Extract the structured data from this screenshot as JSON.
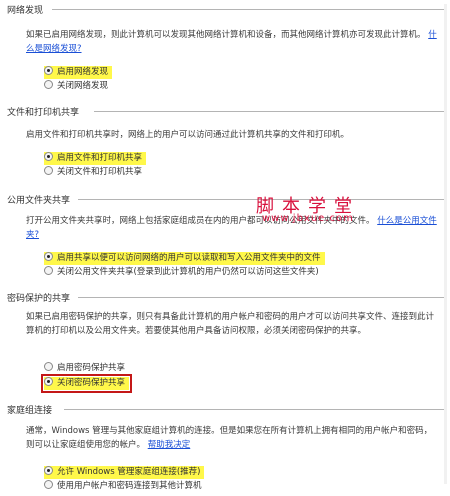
{
  "network_discovery": {
    "title": "网络发现",
    "description": "如果已启用网络发现，则此计算机可以发现其他网络计算机和设备，而其他网络计算机亦可发现此计算机。",
    "link": "什么是网络发现?",
    "options": [
      {
        "label": "启用网络发现",
        "selected": true,
        "highlighted": true
      },
      {
        "label": "关闭网络发现",
        "selected": false,
        "highlighted": false
      }
    ]
  },
  "file_printer_sharing": {
    "title": "文件和打印机共享",
    "description": "启用文件和打印机共享时，网络上的用户可以访问通过此计算机共享的文件和打印机。",
    "options": [
      {
        "label": "启用文件和打印机共享",
        "selected": true,
        "highlighted": true
      },
      {
        "label": "关闭文件和打印机共享",
        "selected": false,
        "highlighted": false
      }
    ]
  },
  "public_folder_sharing": {
    "title": "公用文件夹共享",
    "description": "打开公用文件夹共享时，网络上包括家庭组成员在内的用户都可以访问公用文件夹中的文件。",
    "link": "什么是公用文件夹?",
    "options": [
      {
        "label": "启用共享以便可以访问网络的用户可以读取和写入公用文件夹中的文件",
        "selected": true,
        "highlighted": true
      },
      {
        "label": "关闭公用文件夹共享(登录到此计算机的用户仍然可以访问这些文件夹)",
        "selected": false,
        "highlighted": false
      }
    ]
  },
  "password_protected_sharing": {
    "title": "密码保护的共享",
    "description": "如果已启用密码保护的共享，则只有具备此计算机的用户帐户和密码的用户才可以访问共享文件、连接到此计算机的打印机以及公用文件夹。若要使其他用户具备访问权限，必须关闭密码保护的共享。",
    "options": [
      {
        "label": "启用密码保护共享",
        "selected": false,
        "highlighted": false
      },
      {
        "label": "关闭密码保护共享",
        "selected": true,
        "highlighted": true
      }
    ]
  },
  "homegroup_connections": {
    "title": "家庭组连接",
    "description": "通常，Windows 管理与其他家庭组计算机的连接。但是如果您在所有计算机上拥有相同的用户帐户和密码，则可以让家庭组使用您的帐户。",
    "link": "帮助我决定",
    "options": [
      {
        "label": "允许 Windows 管理家庭组连接(推荐)",
        "selected": true,
        "highlighted": true
      },
      {
        "label": "使用用户帐户和密码连接到其他计算机",
        "selected": false,
        "highlighted": false
      }
    ]
  },
  "watermark": {
    "title": "脚本学堂",
    "url": "www.jbxue.com"
  }
}
